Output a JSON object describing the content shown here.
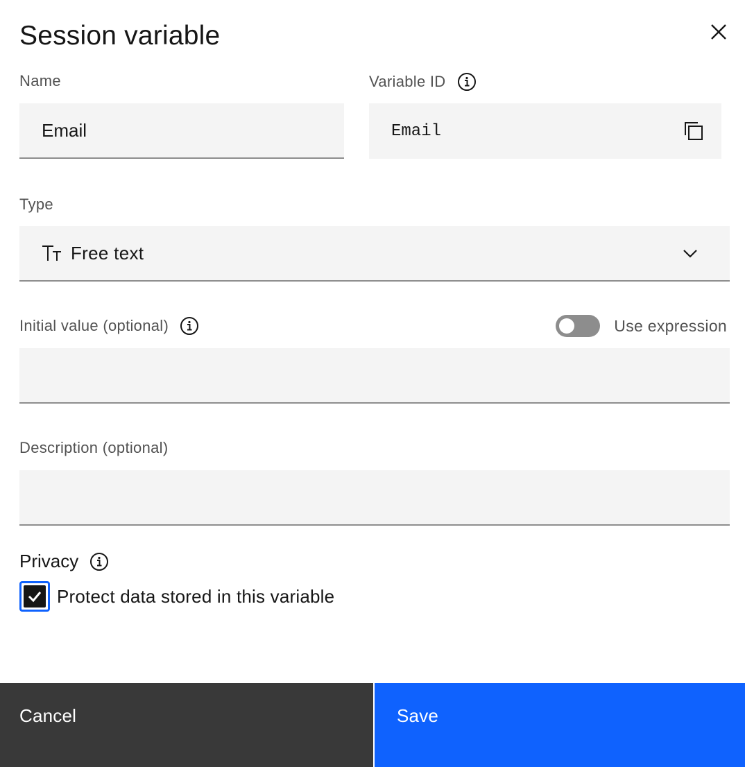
{
  "modal": {
    "title": "Session variable"
  },
  "name_field": {
    "label": "Name",
    "value": "Email"
  },
  "variable_id": {
    "label": "Variable ID",
    "value": "Email"
  },
  "type_field": {
    "label": "Type",
    "icon_glyph": "TT",
    "selected": "Free text"
  },
  "initial_value": {
    "label": "Initial value (optional)",
    "value": "",
    "toggle_label": "Use expression",
    "toggle_on": false
  },
  "description": {
    "label": "Description (optional)",
    "value": ""
  },
  "privacy": {
    "label": "Privacy",
    "checkbox_label": "Protect data stored in this variable",
    "checked": true
  },
  "footer": {
    "cancel_label": "Cancel",
    "save_label": "Save"
  },
  "colors": {
    "primary": "#0f62fe",
    "secondary_button": "#393939",
    "field_bg": "#f4f4f4"
  },
  "icons": [
    "close-icon",
    "info-icon",
    "copy-icon",
    "text-type-icon",
    "chevron-down-icon",
    "checkmark-icon"
  ]
}
